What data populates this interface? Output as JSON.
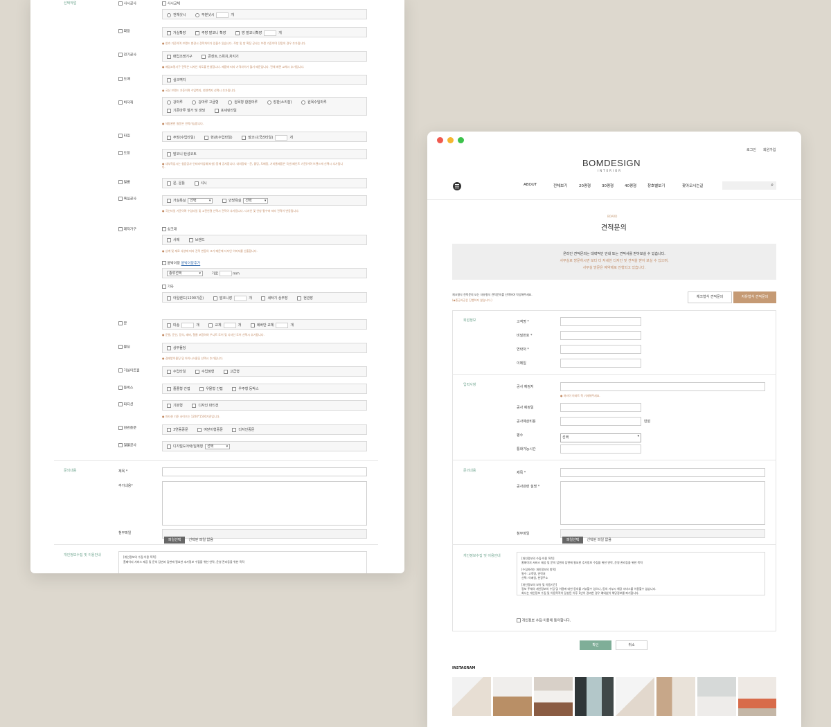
{
  "left": {
    "section_select": "선택작업",
    "rows": [
      {
        "label": "사시공사"
      },
      {
        "label": "확장"
      },
      {
        "label": "전기공사"
      },
      {
        "label": "도배"
      },
      {
        "label": "바닥재"
      },
      {
        "label": "타일"
      },
      {
        "label": "도장"
      },
      {
        "label": "필름"
      },
      {
        "label": "욕실공사"
      },
      {
        "label": "제작가구"
      },
      {
        "label": "문"
      },
      {
        "label": "몰딩"
      },
      {
        "label": "거실아트월"
      },
      {
        "label": "등박스"
      },
      {
        "label": "파티션"
      },
      {
        "label": "현관중문"
      },
      {
        "label": "철물공사"
      }
    ],
    "sash_replace": "사시교체",
    "sash_opts": [
      "전체샷시",
      "부분샷시",
      "개"
    ],
    "expand_opts": [
      "거실확장",
      "주방 발코니 확장",
      "방 발코니확장",
      "개"
    ],
    "expand_note": "● 창호 기준이며 브랜드 변경시 견적차이가 있을수 있습니다. 주방 및 방 확장 공사는 브랜 기준이며 전망의 경우 추가됩니다.",
    "elec_opts": [
      "매입조명기구",
      "콘센트,스위치,차지기"
    ],
    "elec_note": "● 매입조명기구 견적은 디자인 의도를 반영합니다. 제품에 따라 가격차이가 많기 때문입니다. 전체 배관 교체시 추가됩니다.",
    "wall_opts": [
      "실크벽지"
    ],
    "wall_note": "● 국산 브랜드 기준이며 수입벽지, 천연벽지 선택시 추가됩니다.",
    "floor_opts": [
      "강마루",
      "강마루 고급형",
      "원목형 합판마루",
      "장판(소리잠)",
      "원목수입마루"
    ],
    "floor_opts2": [
      "기존마루 철거 및 샌딩",
      "포세린타일"
    ],
    "floor_note": "● 체험관련 질문은 견적가능합니다.",
    "tile_opts": [
      "주방(수입타일)",
      "현관(수입타일)",
      "발코니(국산타일)",
      "개"
    ],
    "paint_opts": [
      "발코니 탄성코트"
    ],
    "paint_note": "● 내부작업시는 첨음공사 인테리어업체(타설) 함께 공사합니다. 내외장재 - 문, 몰딩, 도배장, 거미줄제품은 국산(페인트 기준)이며 브랜드에 선택시 추가됩니다.",
    "film_opts": [
      "문, 문틀",
      "샤시"
    ],
    "bath_opts": [
      "거실욕실",
      "선택",
      "안방욕실",
      "선택"
    ],
    "bath_note": "● 국산타일 기준이며 수입타일 및 고전연결 선택시 견적이 추가됩니다. 디자인 및 안방 평수에 따라 견적이 변동됩니다.",
    "furn_title": "싱크대",
    "furn_opts": [
      "사제",
      "브랜드"
    ],
    "furn_note": "● 상계 및 재료 사양에 따라 견적 변동의 크기 때문에 디자인 이미지를 산출합니다.",
    "closet_label": "붙박이장",
    "closet_link": "붙박이장추가",
    "closet_select": "종류선택",
    "closet_w": "가로",
    "closet_unit": "mm",
    "etc_label": "기타",
    "etc_opts": [
      "아일랜드(1200기준)",
      "발코니장",
      "개",
      "세탁기 상부장",
      "현관장"
    ],
    "door_opts": [
      "미송",
      "개",
      "교체",
      "개",
      "레버만 교체",
      "개"
    ],
    "door_note": "● 문들, 문선, 장식, 래버, 철물 포함하여 우니트 도어 및 디자인 도어 선택시 추가됩니다.",
    "mold_opts": [
      "상부몰딩"
    ],
    "mold_note": "● 걸레받이몰딩 및 아이시스몰딩 선택시 추가됩니다.",
    "art_opts": [
      "수입타일",
      "수입정형",
      "고급형"
    ],
    "light_opts": [
      "줄줄형 간접",
      "우물형 간접",
      "우주형 등박스"
    ],
    "part_opts": [
      "기본형",
      "디자인 파티션"
    ],
    "part_note": "● 파티션 기준 사이즈는 1200*1500기준입니다.",
    "jung_opts": [
      "3연동중문",
      "여닫이형중문",
      "디자인중문"
    ],
    "hw_opts": [
      "디지털도어락/일체형",
      "선택"
    ],
    "section_inquiry": "문의내용",
    "title_label": "제목 *",
    "content_label": "추가내용*",
    "file_label": "첨부파일",
    "file_btn": "파일선택",
    "file_none": "선택된 파일 없음",
    "section_privacy": "개인정보수집 및 이용안내",
    "privacy_l1": "[개인정보의 수집·이용 목적]",
    "privacy_l2": "홈페이지 서비스 제공 및 문의 답변과 답변에 필요한 추가정보 수집을 위한 연락, 운영 관리등을 위한 목적"
  },
  "right": {
    "top_links": [
      "로그인",
      "회원가입"
    ],
    "logo": "BOMDESIGN",
    "logo_sub": "INTERIOR",
    "menu": [
      "ABOUT",
      "전체보기",
      "20평형",
      "30평형",
      "40평형",
      "창호별보기",
      "찾아오시는길"
    ],
    "board_label": "BOARD",
    "page_title": "견적문의",
    "info_l1": "온라인 견적문의는 대략적인 안내 또는 견적서를 받아보실 수 있습니다.",
    "info_l2": "사무실로 방문하시면 보다 더 자세한 디자인 및 견적을 받아 보실 수 있으며,",
    "info_l3": "사무실 방문은 예약제로 진행되고 있습니다.",
    "choose_text": "체크형식 견적문의 또는 자유형식 견적문의를 선택하여 작성해주세요.",
    "choose_note": "(◆중공사공은 진행하지 않습니다.)",
    "tab_check": "체크형식 견적문의",
    "tab_free": "자유형식 견적문의",
    "sec_member": "회원정보",
    "f_name": "고객명 *",
    "f_pw": "비밀번호 *",
    "f_phone": "연락처 *",
    "f_email": "이메일",
    "sec_input": "입력사항",
    "f_site": "공사 예정지",
    "site_note": "● 여러이 아파트 쪽 기재해주세요.",
    "f_date": "공사 예정일",
    "f_budget": "공사예상비용",
    "budget_unit": "만원",
    "f_area": "평수",
    "area_select": "선택",
    "f_time": "통화가능시간",
    "sec_inquiry": "문의내용",
    "f_title": "제목 *",
    "f_desc": "공사관련 설명 *",
    "f_file": "첨부파일",
    "file_btn": "파일선택",
    "file_none": "선택된 파일 없음",
    "sec_privacy": "개인정보수집 및 이용안내",
    "priv": [
      "[개인정보의 수집·이용 목적]",
      "홈페이지 서비스 제공 및 문의 답변과 답변에 필요한 추가정보 수집을 위한 연락, 운영 관리등을 위한 목적",
      "[수집하려는 개인정보의 항목]",
      "필수: 고객명, 연락처",
      "선택: 이메일, 현장주소",
      "[개인정보의 보유 및 이용기간]",
      "정보 주체의 개인정보의 수집 및 이용에 대한 동의를 거부할수 있으나, 동의 거부시 해당 서비스를 이용할수 없습니다.",
      "회사는 개인정보 수집 및 이용목적이 달성된 이후 1년이 경과한 경우 예외없이 해당정보를 파기합니다."
    ],
    "agree": "개인정보 수집·이용에 동의합니다.",
    "btn_ok": "확인",
    "btn_cancel": "취소",
    "instagram": "INSTAGRAM"
  },
  "colors": {
    "accent_green": "#6fa58f",
    "accent_brown": "#c59a74",
    "note_orange": "#c28a63"
  }
}
